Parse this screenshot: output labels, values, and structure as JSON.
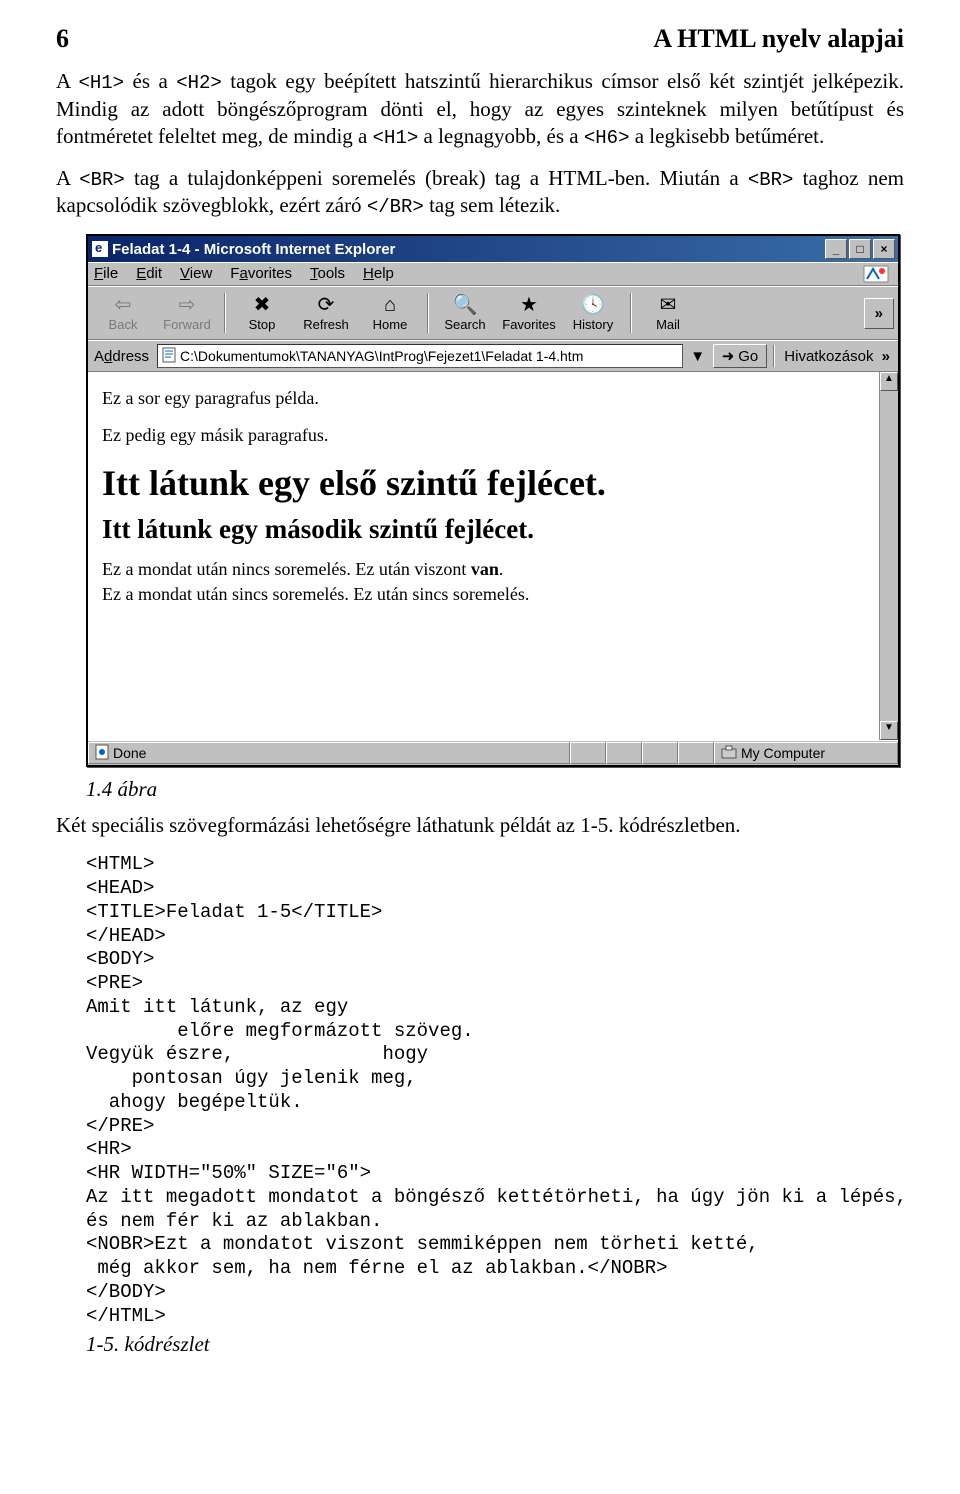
{
  "header": {
    "page_number": "6",
    "title": "A HTML nyelv alapjai"
  },
  "para1_a": "A ",
  "para1_b": "<H1>",
  "para1_c": " és a ",
  "para1_d": "<H2>",
  "para1_e": " tagok egy beépített hatszintű hierarchikus címsor első két szintjét jelképezik. Mindig az adott böngészőprogram dönti el, hogy az egyes szinteknek milyen betűtípust és fontméretet feleltet meg, de mindig a ",
  "para1_f": "<H1>",
  "para1_g": " a legnagyobb, és a ",
  "para1_h": "<H6>",
  "para1_i": " a legkisebb betűméret.",
  "para2_a": "A ",
  "para2_b": "<BR>",
  "para2_c": " tag a tulajdonképpeni soremelés (break) tag a HTML-ben. Miután a ",
  "para2_d": "<BR>",
  "para2_e": " taghoz nem kapcsolódik szövegblokk, ezért záró ",
  "para2_f": "</BR>",
  "para2_g": " tag sem létezik.",
  "browser": {
    "title": "Feladat 1-4 - Microsoft Internet Explorer",
    "win": {
      "min": "_",
      "max": "□",
      "close": "×"
    },
    "menu": {
      "file": "File",
      "edit": "Edit",
      "view": "View",
      "favorites": "Favorites",
      "tools": "Tools",
      "help": "Help"
    },
    "toolbar": {
      "back": "Back",
      "forward": "Forward",
      "stop": "Stop",
      "refresh": "Refresh",
      "home": "Home",
      "search": "Search",
      "favorites": "Favorites",
      "history": "History",
      "mail": "Mail",
      "more": "»"
    },
    "address": {
      "label": "Address",
      "value": "C:\\Dokumentumok\\TANANYAG\\IntProg\\Fejezet1\\Feladat 1-4.htm",
      "go": "Go",
      "links": "Hivatkozások",
      "links_more": "»"
    },
    "content": {
      "p1": "Ez a sor egy paragrafus példa.",
      "p2": "Ez pedig egy másik paragrafus.",
      "h1": "Itt látunk egy első szintű fejlécet.",
      "h2": "Itt látunk egy második szintű fejlécet.",
      "l1a": "Ez a mondat után nincs soremelés. Ez után viszont ",
      "l1b": "van",
      "l2": "Ez a mondat után sincs soremelés. Ez után sincs soremelés."
    },
    "status": {
      "done": "Done",
      "zone": "My Computer"
    }
  },
  "fig_caption": "1.4 ábra",
  "para3": "Két speciális szövegformázási lehetőségre láthatunk példát az 1-5. kódrészletben.",
  "code": "<HTML>\n<HEAD>\n<TITLE>Feladat 1-5</TITLE>\n</HEAD>\n<BODY>\n<PRE>\nAmit itt látunk, az egy\n        előre megformázott szöveg.\nVegyük észre,             hogy\n    pontosan úgy jelenik meg,\n  ahogy begépeltük.\n</PRE>\n<HR>\n<HR WIDTH=\"50%\" SIZE=\"6\">\nAz itt megadott mondatot a böngésző kettétörheti, ha úgy jön ki a lépés,\nés nem fér ki az ablakban.\n<NOBR>Ezt a mondatot viszont semmiképpen nem törheti ketté,\n még akkor sem, ha nem férne el az ablakban.</NOBR>\n</BODY>\n</HTML>",
  "code_caption": "1-5. kódrészlet"
}
